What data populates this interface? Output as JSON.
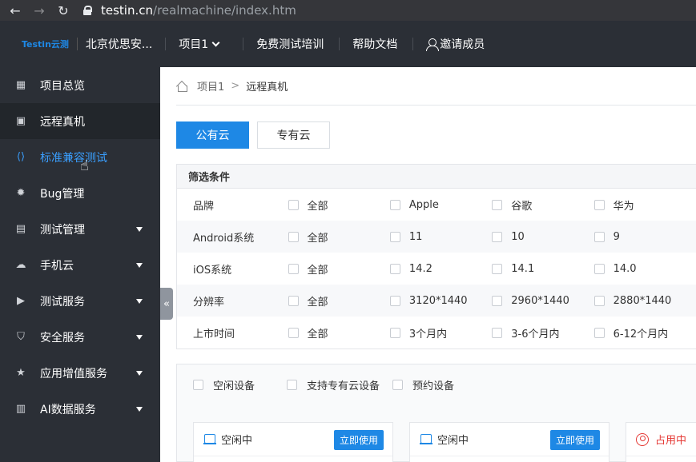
{
  "browser": {
    "back_glyph": "←",
    "forward_glyph": "→",
    "reload_glyph": "↻",
    "url_host": "testin.cn",
    "url_path": "/realmachine/index.htm"
  },
  "topnav": {
    "logo": "Testin云测",
    "org_name": "北京优思安...",
    "project": "项目1",
    "links": [
      "免费测试培训",
      "帮助文档"
    ],
    "invite": "邀请成员"
  },
  "sidebar": {
    "items": [
      {
        "label": "项目总览",
        "icon": "grid-icon",
        "glyph": "▦"
      },
      {
        "label": "远程真机",
        "icon": "device-icon",
        "glyph": "▣"
      },
      {
        "label": "标准兼容测试",
        "icon": "code-icon",
        "glyph": "⟨⟩"
      },
      {
        "label": "Bug管理",
        "icon": "bug-icon",
        "glyph": "✹"
      },
      {
        "label": "测试管理",
        "icon": "document-icon",
        "glyph": "▤"
      },
      {
        "label": "手机云",
        "icon": "cloud-icon",
        "glyph": "☁"
      },
      {
        "label": "测试服务",
        "icon": "terminal-icon",
        "glyph": "▶"
      },
      {
        "label": "安全服务",
        "icon": "shield-icon",
        "glyph": "⛉"
      },
      {
        "label": "应用增值服务",
        "icon": "star-icon",
        "glyph": "★"
      },
      {
        "label": "AI数据服务",
        "icon": "chart-icon",
        "glyph": "▥"
      }
    ],
    "collapse_glyph": "«",
    "cursor_glyph": "☝"
  },
  "breadcrumb": {
    "project": "项目1",
    "sep": ">",
    "current": "远程真机"
  },
  "tabs": [
    "公有云",
    "专有云"
  ],
  "filter": {
    "title": "筛选条件",
    "rows": [
      {
        "label": "品牌",
        "options": [
          "全部",
          "Apple",
          "谷歌",
          "华为"
        ]
      },
      {
        "label": "Android系统",
        "options": [
          "全部",
          "11",
          "10",
          "9"
        ]
      },
      {
        "label": "iOS系统",
        "options": [
          "全部",
          "14.2",
          "14.1",
          "14.0"
        ]
      },
      {
        "label": "分辨率",
        "options": [
          "全部",
          "3120*1440",
          "2960*1440",
          "2880*1440"
        ]
      },
      {
        "label": "上市时间",
        "options": [
          "全部",
          "3个月内",
          "3-6个月内",
          "6-12个月内"
        ]
      }
    ]
  },
  "device_filter": [
    "空闲设备",
    "支持专有云设备",
    "预约设备"
  ],
  "cards": [
    {
      "status": "空闲中",
      "button": "立即使用"
    },
    {
      "status": "空闲中",
      "button": "立即使用"
    },
    {
      "status": "占用中"
    }
  ],
  "colors": {
    "accent": "#1e88e5",
    "busy": "#e53935",
    "nav_bg": "#2b2f36"
  }
}
